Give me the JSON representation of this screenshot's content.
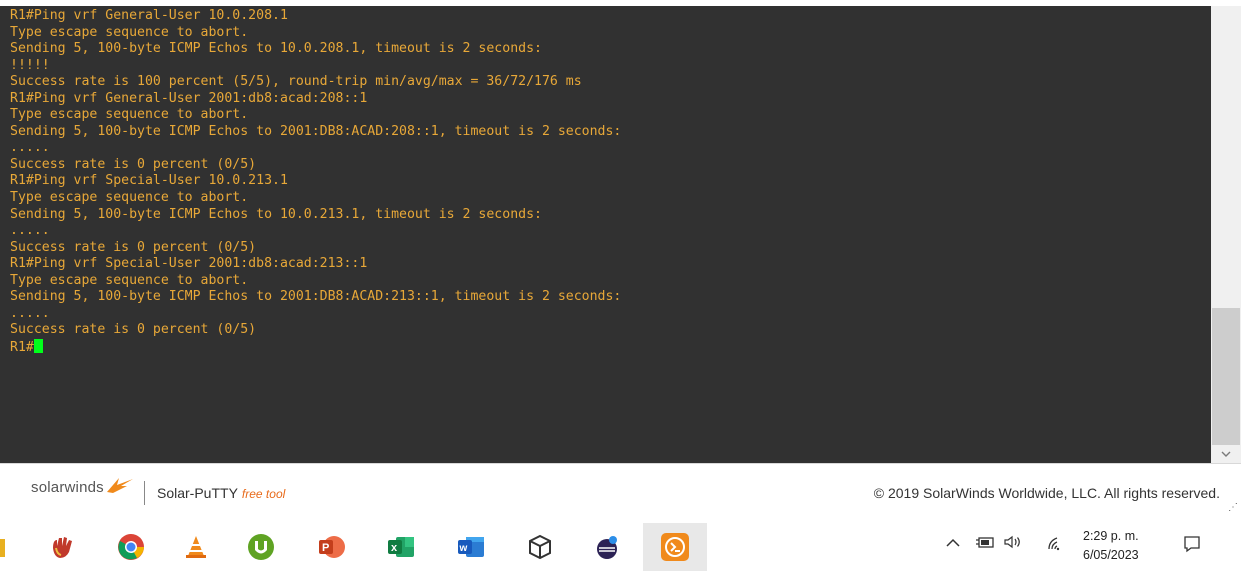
{
  "terminal": {
    "lines": [
      "R1#Ping vrf General-User 10.0.208.1",
      "Type escape sequence to abort.",
      "Sending 5, 100-byte ICMP Echos to 10.0.208.1, timeout is 2 seconds:",
      "!!!!!",
      "Success rate is 100 percent (5/5), round-trip min/avg/max = 36/72/176 ms",
      "R1#Ping vrf General-User 2001:db8:acad:208::1",
      "Type escape sequence to abort.",
      "Sending 5, 100-byte ICMP Echos to 2001:DB8:ACAD:208::1, timeout is 2 seconds:",
      ".....",
      "Success rate is 0 percent (0/5)",
      "R1#Ping vrf Special-User 10.0.213.1",
      "Type escape sequence to abort.",
      "Sending 5, 100-byte ICMP Echos to 10.0.213.1, timeout is 2 seconds:",
      ".....",
      "Success rate is 0 percent (0/5)",
      "R1#Ping vrf Special-User 2001:db8:acad:213::1",
      "Type escape sequence to abort.",
      "Sending 5, 100-byte ICMP Echos to 2001:DB8:ACAD:213::1, timeout is 2 seconds:",
      ".....",
      "Success rate is 0 percent (0/5)"
    ],
    "prompt": "R1#",
    "text_color": "#e8a838",
    "cursor_color": "#00ff1a",
    "background": "#313131"
  },
  "footer": {
    "brand": "solarwinds",
    "product": "Solar-PuTTY",
    "product_tag": "free tool",
    "copyright": "© 2019 SolarWinds Worldwide, LLC. All rights reserved."
  },
  "taskbar": {
    "apps": [
      {
        "name": "unknown-app-icon"
      },
      {
        "name": "hand-app-icon"
      },
      {
        "name": "chrome-icon"
      },
      {
        "name": "vlc-icon"
      },
      {
        "name": "utorrent-icon"
      },
      {
        "name": "powerpoint-icon"
      },
      {
        "name": "excel-icon"
      },
      {
        "name": "word-icon"
      },
      {
        "name": "virtualbox-icon"
      },
      {
        "name": "eclipse-icon"
      },
      {
        "name": "solar-putty-icon"
      }
    ],
    "clock_time": "2:29 p. m.",
    "clock_date": "6/05/2023"
  }
}
